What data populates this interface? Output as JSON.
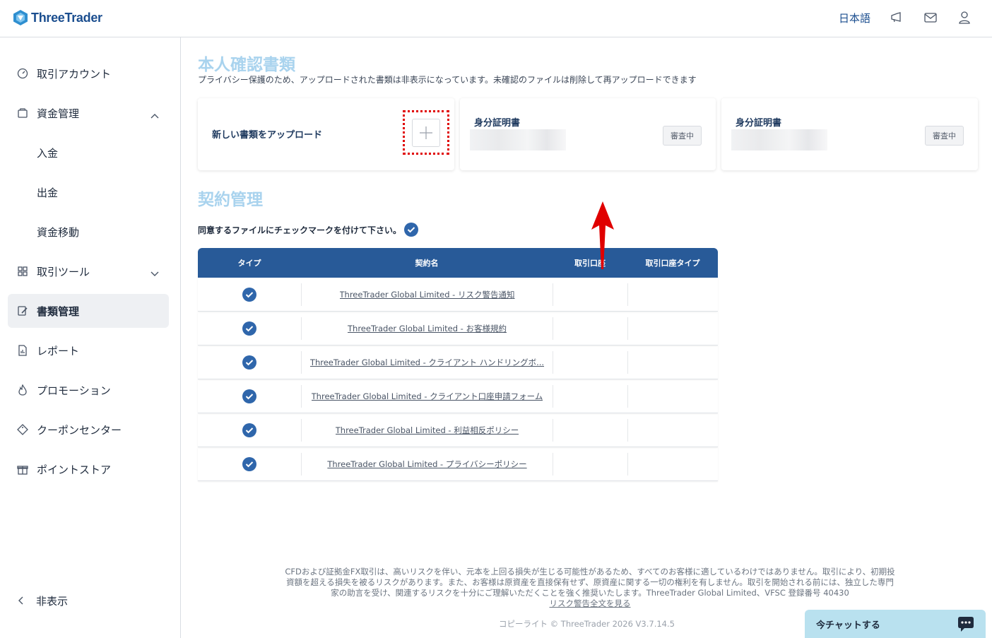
{
  "header": {
    "logo_text": "ThreeTrader",
    "language": "日本語",
    "icons": [
      "megaphone-icon",
      "mail-icon",
      "user-icon"
    ]
  },
  "sidebar": {
    "items": [
      {
        "label": "取引アカウント",
        "icon": "gauge-icon"
      },
      {
        "label": "資金管理",
        "icon": "wallet-icon",
        "expanded": true
      },
      {
        "label": "入金"
      },
      {
        "label": "出金"
      },
      {
        "label": "資金移動"
      },
      {
        "label": "取引ツール",
        "icon": "tools-icon",
        "expanded": false
      },
      {
        "label": "書類管理",
        "icon": "document-edit-icon",
        "active": true
      },
      {
        "label": "レポート",
        "icon": "report-icon"
      },
      {
        "label": "プロモーション",
        "icon": "flame-icon"
      },
      {
        "label": "クーポンセンター",
        "icon": "ticket-icon"
      },
      {
        "label": "ポイントストア",
        "icon": "gift-icon"
      }
    ],
    "hide_label": "非表示"
  },
  "identity": {
    "title": "本人確認書類",
    "notice": "プライバシー保護のため、アップロードされた書類は非表示になっています。未確認のファイルは削除して再アップロードできます",
    "upload_label": "新しい書類をアップロード",
    "documents": [
      {
        "title": "身分証明書",
        "status": "審査中"
      },
      {
        "title": "身分証明書",
        "status": "審査中"
      }
    ]
  },
  "contracts": {
    "title": "契約管理",
    "agree_text": "同意するファイルにチェックマークを付けて下さい。",
    "columns": [
      "タイプ",
      "契約名",
      "取引口座",
      "取引口座タイプ"
    ],
    "rows": [
      {
        "checked": true,
        "name": "ThreeTrader Global Limited - リスク警告通知",
        "account": "",
        "account_type": ""
      },
      {
        "checked": true,
        "name": "ThreeTrader Global Limited - お客様規約",
        "account": "",
        "account_type": ""
      },
      {
        "checked": true,
        "name": "ThreeTrader Global Limited - クライアント ハンドリングボ...",
        "account": "",
        "account_type": ""
      },
      {
        "checked": true,
        "name": "ThreeTrader Global Limited - クライアント口座申請フォーム",
        "account": "",
        "account_type": ""
      },
      {
        "checked": true,
        "name": "ThreeTrader Global Limited - 利益相反ポリシー",
        "account": "",
        "account_type": ""
      },
      {
        "checked": true,
        "name": "ThreeTrader Global Limited - プライバシーポリシー",
        "account": "",
        "account_type": ""
      }
    ]
  },
  "footer": {
    "risk_text": "CFDおよび証拠金FX取引は、高いリスクを伴い、元本を上回る損失が生じる可能性があるため、すべてのお客様に適しているわけではありません。取引により、初期投資額を超える損失を被るリスクがあります。また、お客様は原資産を直接保有せず、原資産に関する一切の権利を有しません。取引を開始される前には、独立した専門家の助言を受け、関連するリスクを十分にご理解いただくことを強く推奨いたします。ThreeTrader Global Limited、VFSC 登録番号 40430",
    "risk_link": "リスク警告全文を見る",
    "copyright": "コピーライト © ThreeTrader 2026 V3.7.14.5"
  },
  "chat": {
    "label": "今チャットする"
  },
  "colors": {
    "brand": "#1b4e8f",
    "table_header": "#285a98",
    "section_title": "#a9d3ee",
    "annotation_red": "#e00000"
  }
}
